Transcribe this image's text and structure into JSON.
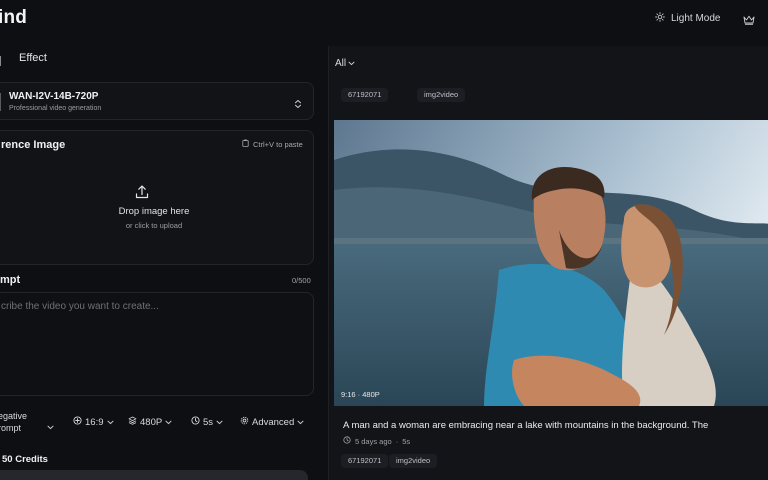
{
  "brand": {
    "name": "ind"
  },
  "header": {
    "light_mode_label": "Light Mode"
  },
  "left": {
    "tabs": {
      "effect": "Effect"
    },
    "model": {
      "name": "WAN-I2V-14B-720P",
      "description": "Professional video generation"
    },
    "reference": {
      "title": "rence Image",
      "paste_hint": "Ctrl+V to paste",
      "drop_main": "Drop image here",
      "drop_sub": "or click to upload"
    },
    "prompt": {
      "title": "mpt",
      "count": "0/500",
      "placeholder": "cribe the video you want to create..."
    },
    "options": {
      "negative_line1": "egative",
      "negative_line2": "rompt",
      "aspect": "16:9",
      "resolution": "480P",
      "duration": "5s",
      "advanced": "Advanced"
    },
    "credits": "50 Credits"
  },
  "right": {
    "filter": "All",
    "top_tags": [
      "67192071",
      "img2video"
    ],
    "card": {
      "overlay": "9:16 · 480P",
      "description": "A man and a woman are embracing near a lake with mountains in the background. The",
      "time": "5 days ago",
      "duration": "5s",
      "tags": [
        "67192071",
        "img2video"
      ]
    }
  }
}
